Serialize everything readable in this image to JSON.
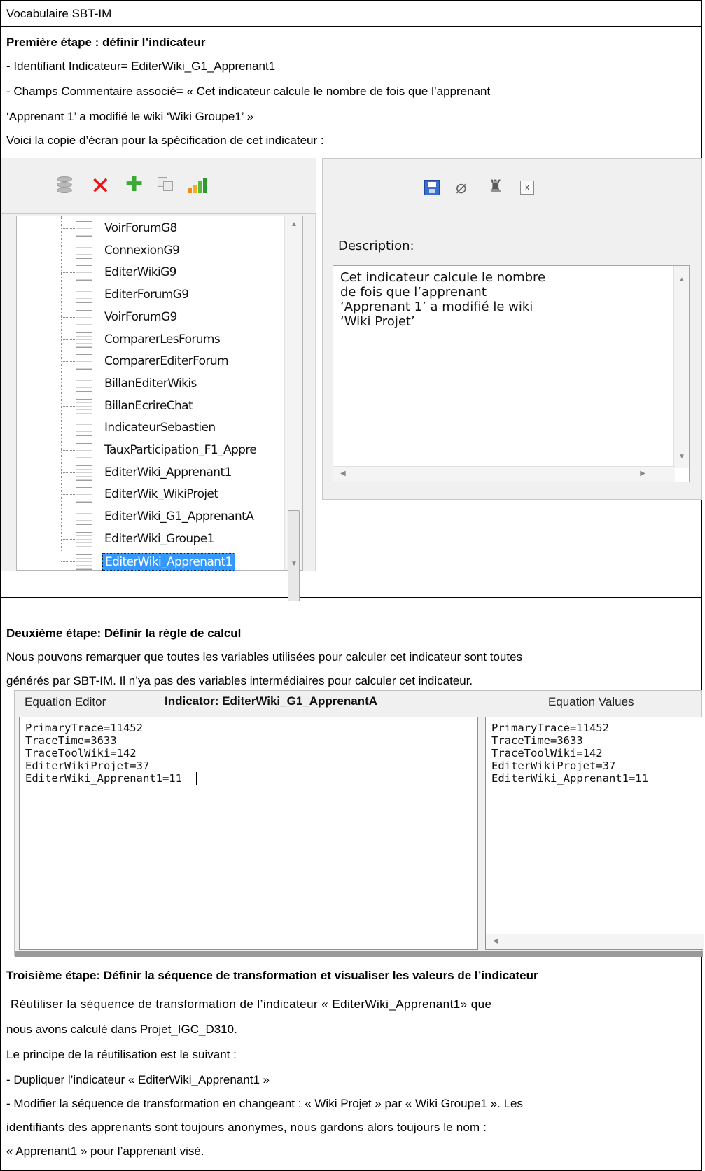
{
  "header": {
    "title": "Vocabulaire SBT-IM"
  },
  "step1": {
    "heading": "Première étape : définir l’indicateur",
    "line_identifier": "- Identifiant Indicateur= EditerWiki_G1_Apprenant1",
    "line_comment_1": "- Champs Commentaire associé= « Cet indicateur calcule le nombre de fois que l’apprenant",
    "line_comment_2": "‘Apprenant 1’ a modifié le wiki ‘Wiki Groupe1’ »",
    "line_screenshot": "Voici la copie d’écran pour la spécification de cet indicateur :",
    "left_toolbar_icons": [
      "database-icon",
      "delete-icon",
      "add-icon",
      "copy-icon",
      "chart-icon"
    ],
    "right_toolbar_icons": [
      "save-icon",
      "eraser-icon",
      "binoculars-icon",
      "formula-icon"
    ],
    "tree_items": [
      "VoirForumG8",
      "ConnexionG9",
      "EditerWikiG9",
      "EditerForumG9",
      "VoirForumG9",
      "ComparerLesForums",
      "ComparerEditerForum",
      "BillanEditerWikis",
      "BillanEcrireChat",
      "IndicateurSebastien",
      "TauxParticipation_F1_Appre",
      "EditerWiki_Apprenant1",
      "EditerWik_WikiProjet",
      "EditerWiki_G1_ApprenantA",
      "EditerWiki_Groupe1",
      "EditerWiki_Apprenant1"
    ],
    "selected_index": 15,
    "description_label": "Description:",
    "description_text": "Cet indicateur calcule le nombre\nde fois que l’apprenant\n‘Apprenant 1’ a modifié le wiki\n‘Wiki Projet’"
  },
  "step2": {
    "heading": "Deuxième étape: Définir la règle de calcul",
    "para_1": "Nous pouvons remarquer que toutes les variables utilisées pour calculer cet indicateur sont toutes",
    "para_2": "générés par SBT-IM. Il n’ya pas des variables intermédiaires pour calculer cet indicateur.",
    "editor_tab": "Equation Editor",
    "indicator_label": "Indicator: EditerWiki_G1_ApprenantA",
    "values_tab": "Equation Values",
    "editor_text": "PrimaryTrace=11452\nTraceTime=3633\nTraceToolWiki=142\nEditerWikiProjet=37\nEditerWiki_Apprenant1=11",
    "values_text": "PrimaryTrace=11452\nTraceTime=3633\nTraceToolWiki=142\nEditerWikiProjet=37\nEditerWiki_Apprenant1=11"
  },
  "step3": {
    "heading": "Troisième étape: Définir la séquence de transformation et visualiser les valeurs de l’indicateur",
    "para_1": "Réutiliser la séquence de transformation de l’indicateur « EditerWiki_Apprenant1» que",
    "para_2": "nous avons calculé dans Projet_IGC_D310.",
    "para_3": "Le principe de la réutilisation est le suivant :",
    "bullet_1": "- Dupliquer l’indicateur « EditerWiki_Apprenant1 »",
    "bullet_2a": "- Modifier la séquence de transformation en changeant : « Wiki Projet » par « Wiki Groupe1 ». Les",
    "bullet_2b": "identifiants des apprenants sont toujours anonymes, nous gardons alors toujours le nom :",
    "bullet_2c": "« Apprenant1 » pour l’apprenant visé."
  }
}
